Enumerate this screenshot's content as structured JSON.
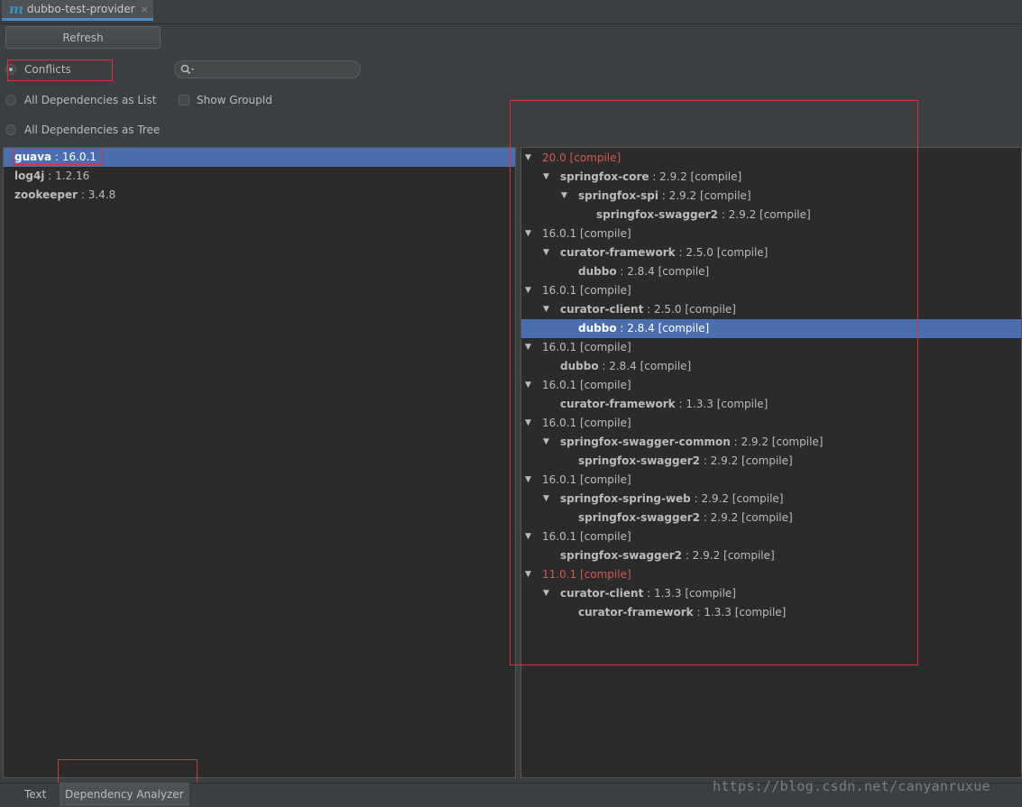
{
  "tab": {
    "icon": "m",
    "title": "dubbo-test-provider",
    "close": "×"
  },
  "toolbar": {
    "refresh_label": "Refresh"
  },
  "options": {
    "conflicts": "Conflicts",
    "all_list": "All Dependencies as List",
    "all_tree": "All Dependencies as Tree",
    "show_groupid": "Show GroupId"
  },
  "search": {
    "value": "",
    "placeholder": ""
  },
  "left_list": [
    {
      "name": "guava",
      "version": " : 16.0.1"
    },
    {
      "name": "log4j",
      "version": " : 1.2.16"
    },
    {
      "name": "zookeeper",
      "version": " : 3.4.8"
    }
  ],
  "tree": [
    {
      "level": 0,
      "arrow": "▼",
      "name": "",
      "rest": "20.0 [compile]",
      "red": true
    },
    {
      "level": 1,
      "arrow": "▼",
      "name": "springfox-core",
      "rest": " : 2.9.2 [compile]"
    },
    {
      "level": 2,
      "arrow": "▼",
      "name": "springfox-spi",
      "rest": " : 2.9.2 [compile]"
    },
    {
      "level": 3,
      "arrow": "",
      "name": "springfox-swagger2",
      "rest": " : 2.9.2 [compile]"
    },
    {
      "level": 0,
      "arrow": "▼",
      "name": "",
      "rest": "16.0.1 [compile]"
    },
    {
      "level": 1,
      "arrow": "▼",
      "name": "curator-framework",
      "rest": " : 2.5.0 [compile]"
    },
    {
      "level": 2,
      "arrow": "",
      "name": "dubbo",
      "rest": " : 2.8.4 [compile]"
    },
    {
      "level": 0,
      "arrow": "▼",
      "name": "",
      "rest": "16.0.1 [compile]"
    },
    {
      "level": 1,
      "arrow": "▼",
      "name": "curator-client",
      "rest": " : 2.5.0 [compile]"
    },
    {
      "level": 2,
      "arrow": "",
      "name": "dubbo",
      "rest": " : 2.8.4 [compile]",
      "selected": true
    },
    {
      "level": 0,
      "arrow": "▼",
      "name": "",
      "rest": "16.0.1 [compile]"
    },
    {
      "level": 1,
      "arrow": "",
      "name": "dubbo",
      "rest": " : 2.8.4 [compile]"
    },
    {
      "level": 0,
      "arrow": "▼",
      "name": "",
      "rest": "16.0.1 [compile]"
    },
    {
      "level": 1,
      "arrow": "",
      "name": "curator-framework",
      "rest": " : 1.3.3 [compile]"
    },
    {
      "level": 0,
      "arrow": "▼",
      "name": "",
      "rest": "16.0.1 [compile]"
    },
    {
      "level": 1,
      "arrow": "▼",
      "name": "springfox-swagger-common",
      "rest": " : 2.9.2 [compile]"
    },
    {
      "level": 2,
      "arrow": "",
      "name": "springfox-swagger2",
      "rest": " : 2.9.2 [compile]"
    },
    {
      "level": 0,
      "arrow": "▼",
      "name": "",
      "rest": "16.0.1 [compile]"
    },
    {
      "level": 1,
      "arrow": "▼",
      "name": "springfox-spring-web",
      "rest": " : 2.9.2 [compile]"
    },
    {
      "level": 2,
      "arrow": "",
      "name": "springfox-swagger2",
      "rest": " : 2.9.2 [compile]"
    },
    {
      "level": 0,
      "arrow": "▼",
      "name": "",
      "rest": "16.0.1 [compile]"
    },
    {
      "level": 1,
      "arrow": "",
      "name": "springfox-swagger2",
      "rest": " : 2.9.2 [compile]"
    },
    {
      "level": 0,
      "arrow": "▼",
      "name": "",
      "rest": "11.0.1 [compile]",
      "red": true
    },
    {
      "level": 1,
      "arrow": "▼",
      "name": "curator-client",
      "rest": " : 1.3.3 [compile]"
    },
    {
      "level": 2,
      "arrow": "",
      "name": "curator-framework",
      "rest": " : 1.3.3 [compile]"
    }
  ],
  "bottom_tabs": {
    "text": "Text",
    "analyzer": "Dependency Analyzer"
  },
  "watermark": "https://blog.csdn.net/canyanruxue",
  "colors": {
    "selection": "#4b6eaf",
    "conflict_red": "#d5584d",
    "annotation_red": "#e0303a",
    "tab_underline": "#4a88c7"
  }
}
